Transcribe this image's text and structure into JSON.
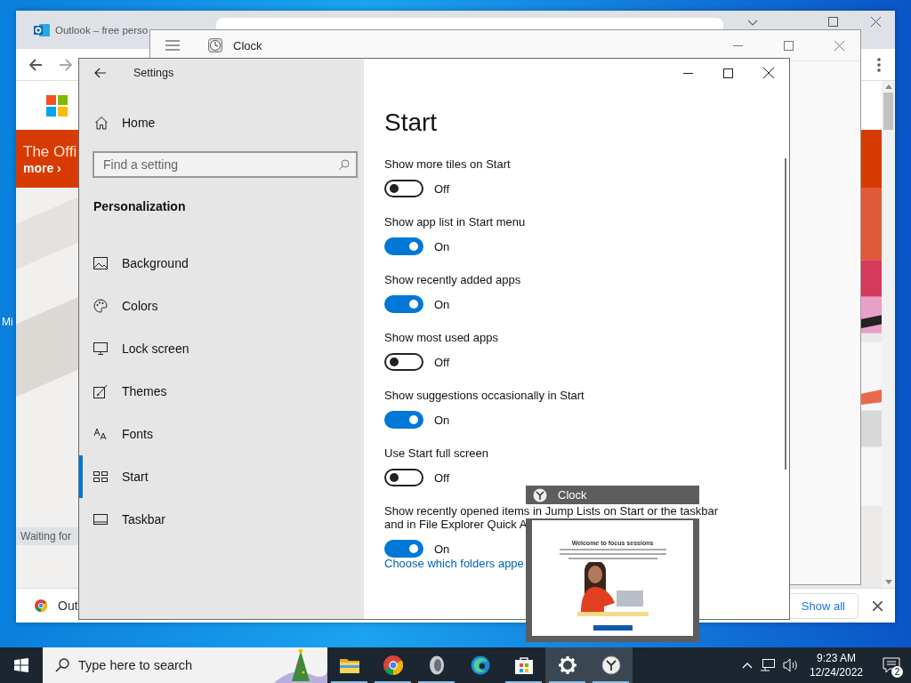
{
  "desktop": {
    "icon_label": "Mi"
  },
  "browser": {
    "tab": {
      "title": "Outlook – free perso"
    },
    "banner": {
      "headline": "The Offi",
      "link": "more ›"
    },
    "status": "Waiting for",
    "download": {
      "item": "Out",
      "show_all": "Show all"
    }
  },
  "clock_window": {
    "title": "Clock"
  },
  "settings": {
    "title": "Settings",
    "home": "Home",
    "search": {
      "placeholder": "Find a setting"
    },
    "section": "Personalization",
    "nav": [
      {
        "kind": "background",
        "label": "Background",
        "selected": false
      },
      {
        "kind": "colors",
        "label": "Colors",
        "selected": false
      },
      {
        "kind": "lock",
        "label": "Lock screen",
        "selected": false
      },
      {
        "kind": "themes",
        "label": "Themes",
        "selected": false
      },
      {
        "kind": "fonts",
        "label": "Fonts",
        "selected": false
      },
      {
        "kind": "start",
        "label": "Start",
        "selected": true
      },
      {
        "kind": "taskbar",
        "label": "Taskbar",
        "selected": false
      }
    ],
    "heading": "Start",
    "options": [
      {
        "label": "Show more tiles on Start",
        "on": false,
        "state_text": "Off"
      },
      {
        "label": "Show app list in Start menu",
        "on": true,
        "state_text": "On"
      },
      {
        "label": "Show recently added apps",
        "on": true,
        "state_text": "On"
      },
      {
        "label": "Show most used apps",
        "on": false,
        "state_text": "Off"
      },
      {
        "label": "Show suggestions occasionally in Start",
        "on": true,
        "state_text": "On"
      },
      {
        "label": "Use Start full screen",
        "on": false,
        "state_text": "Off"
      },
      {
        "label_lines": [
          "Show recently opened items in Jump Lists on Start or the taskbar",
          "and in File Explorer Quick A"
        ],
        "on": true,
        "state_text": "On"
      }
    ],
    "link": "Choose which folders appe"
  },
  "preview": {
    "title": "Clock",
    "welcome": "Welcome to focus sessions"
  },
  "taskbar": {
    "search": {
      "placeholder": "Type here to search"
    },
    "apps": [
      {
        "kind": "folder",
        "running": true,
        "selected": false
      },
      {
        "kind": "chrome",
        "running": true,
        "selected": false
      },
      {
        "kind": "shell",
        "running": true,
        "selected": false
      },
      {
        "kind": "edge",
        "running": false,
        "selected": false
      },
      {
        "kind": "store",
        "running": true,
        "selected": false
      },
      {
        "kind": "settings",
        "running": true,
        "selected": true
      },
      {
        "kind": "clock",
        "running": true,
        "selected": true
      }
    ],
    "time": "9:23 AM",
    "date": "12/24/2022",
    "notifications": "2"
  }
}
